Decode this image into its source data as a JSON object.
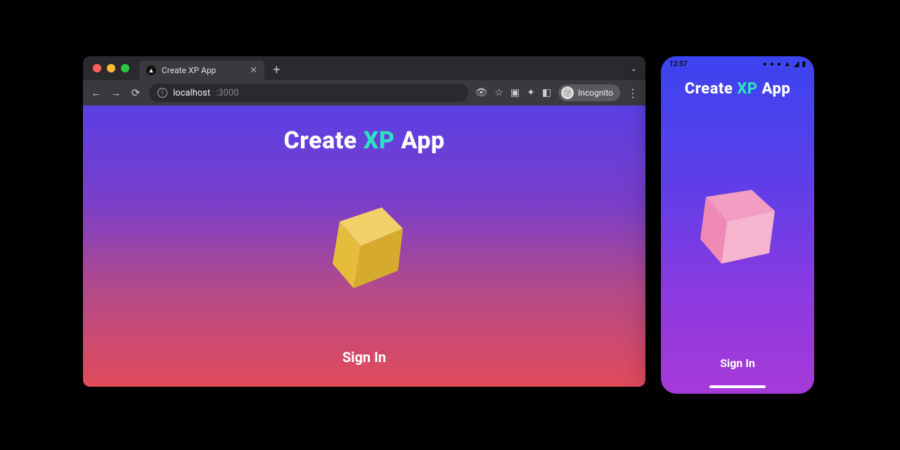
{
  "browser": {
    "tab_title": "Create XP App",
    "url_host": "localhost",
    "url_port": ":3000",
    "incognito_label": "Incognito"
  },
  "app": {
    "title_pre": "Create ",
    "title_accent": "XP",
    "title_post": " App",
    "signin_label": "Sign In"
  },
  "phone": {
    "time": "12:57",
    "title_pre": "Create ",
    "title_accent": "XP",
    "title_post": " App",
    "signin_label": "Sign In"
  },
  "colors": {
    "browser_gradient": [
      "#5b3fe4",
      "#e24a5a"
    ],
    "phone_gradient": [
      "#3b44f0",
      "#a63ad8"
    ],
    "accent_text": "#2de0c0",
    "cube_yellow": {
      "front": "#e6bd3a",
      "side": "#d6aa2d",
      "top": "#f2d06a"
    },
    "cube_pink": {
      "front": "#ef8ab6",
      "side": "#f7b4cf",
      "top": "#f39dc3"
    }
  }
}
